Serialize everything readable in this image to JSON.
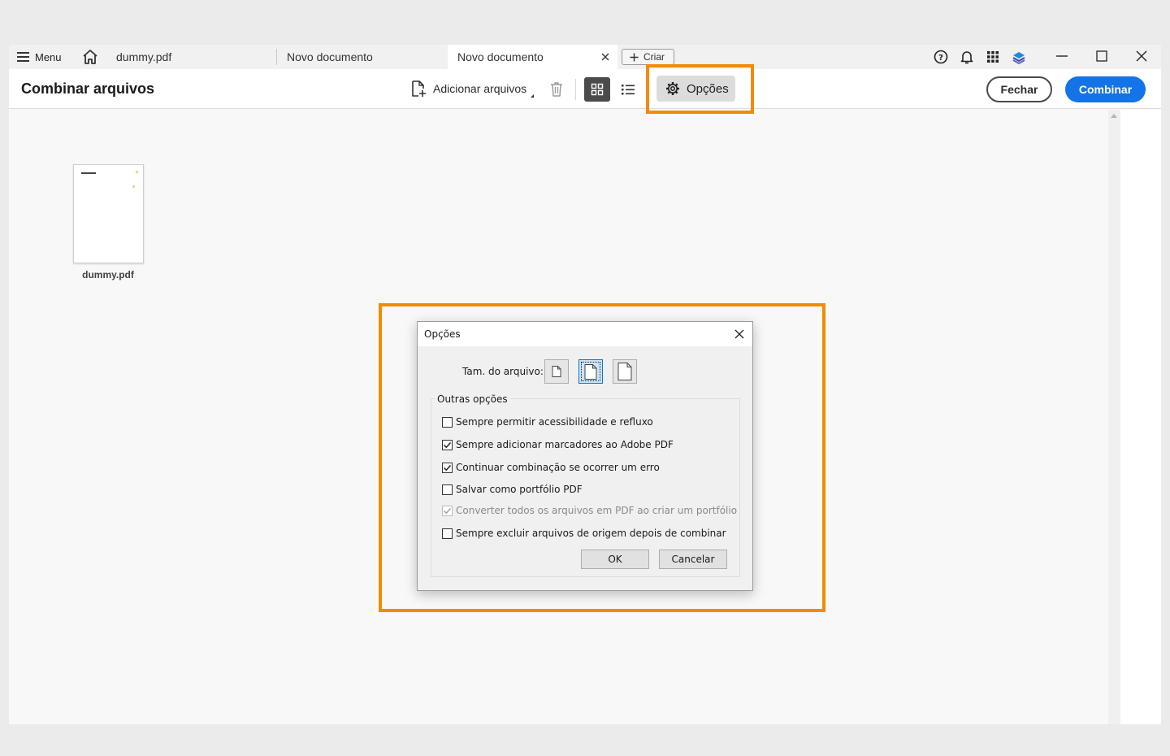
{
  "tabbar": {
    "menu_label": "Menu",
    "tabs": [
      {
        "label": "dummy.pdf"
      },
      {
        "label": "Novo documento"
      },
      {
        "label": "Novo documento"
      }
    ],
    "create_label": "Criar",
    "icons": [
      "help-icon",
      "bell-icon",
      "apps-grid-icon",
      "layers-icon",
      "minimize-icon",
      "maximize-icon",
      "close-icon"
    ]
  },
  "toolbar": {
    "title": "Combinar arquivos",
    "add_files_label": "Adicionar arquivos",
    "options_label": "Opções",
    "close_label": "Fechar",
    "combine_label": "Combinar"
  },
  "content": {
    "files": [
      {
        "name": "dummy.pdf"
      }
    ]
  },
  "dialog": {
    "title": "Opções",
    "file_size_label": "Tam. do arquivo:",
    "file_size_options": [
      "small",
      "medium",
      "large"
    ],
    "file_size_selected": "medium",
    "group_title": "Outras opções",
    "options": [
      {
        "label": "Sempre permitir acessibilidade e refluxo",
        "checked": false,
        "disabled": false
      },
      {
        "label": "Sempre adicionar marcadores ao Adobe PDF",
        "checked": true,
        "disabled": false
      },
      {
        "label": "Continuar combinação se ocorrer um erro",
        "checked": true,
        "disabled": false
      },
      {
        "label": "Salvar como portfólio PDF",
        "checked": false,
        "disabled": false
      },
      {
        "label": "Converter todos os arquivos em PDF ao criar um portfólio",
        "checked": true,
        "disabled": true
      },
      {
        "label": "Sempre excluir arquivos de origem depois de combinar",
        "checked": false,
        "disabled": false
      }
    ],
    "ok_label": "OK",
    "cancel_label": "Cancelar"
  },
  "colors": {
    "accent": "#1473e6",
    "highlight": "#f28b00"
  }
}
